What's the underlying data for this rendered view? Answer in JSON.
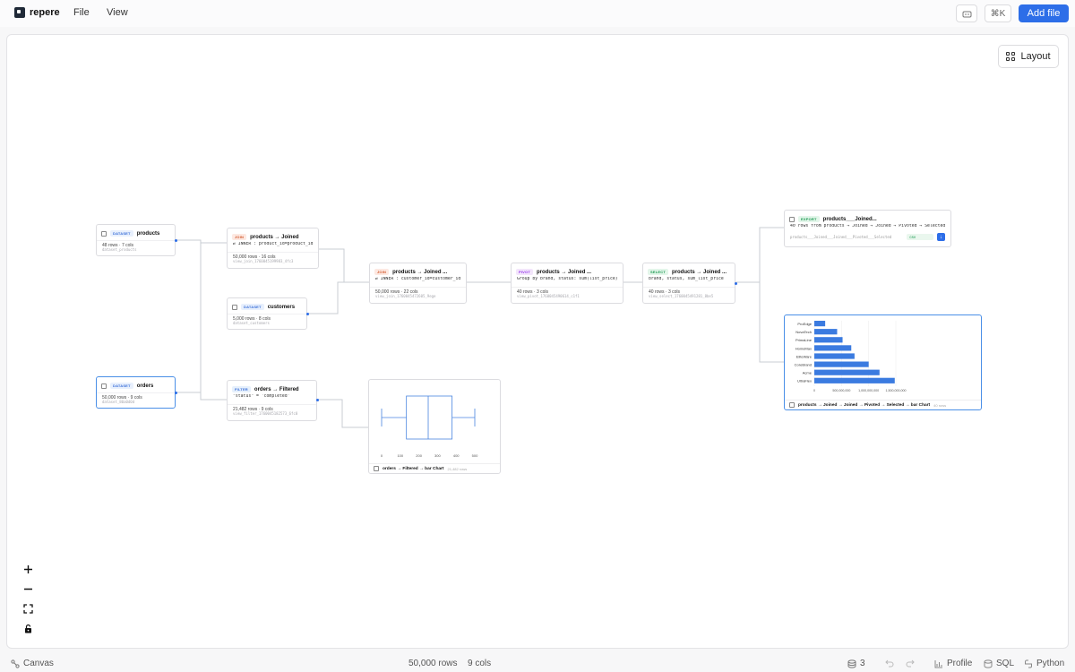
{
  "app": {
    "name": "repere"
  },
  "menu": {
    "file": "File",
    "view": "View"
  },
  "toolbar": {
    "shortcut": "⌘K",
    "add_file": "Add file",
    "layout": "Layout"
  },
  "nodes": {
    "products": {
      "badge": "DATASET",
      "title": "products",
      "meta": "48 rows · 7 cols",
      "sub": "dataset_products"
    },
    "customers": {
      "badge": "DATASET",
      "title": "customers",
      "meta": "5,000 rows · 8 cols",
      "sub": "dataset_customers"
    },
    "orders": {
      "badge": "DATASET",
      "title": "orders",
      "meta": "50,000 rows · 9 cols",
      "sub": "dataset_80a0d0d"
    },
    "join1": {
      "badge": "JOIN",
      "title": "products → Joined",
      "line": "⇄ INNER : product_id=product_id",
      "meta": "50,000 rows · 16 cols",
      "sub": "view_join_1760045199983_4fc3"
    },
    "join2": {
      "badge": "JOIN",
      "title": "products → Joined ...",
      "line": "⇄ INNER : customer_id=customer_id",
      "meta": "50,000 rows · 22 cols",
      "sub": "view_join_1760045472605_9ege"
    },
    "filter": {
      "badge": "FILTER",
      "title": "orders → Filtered",
      "line": "\"status\" = 'completed'",
      "meta": "21,482 rows · 9 cols",
      "sub": "view_filter_1760045182573_6fc0"
    },
    "pivot": {
      "badge": "PIVOT",
      "title": "products → Joined ...",
      "line": "Group by brand, status: sum(list_price)",
      "meta": "40 rows · 3 cols",
      "sub": "view_pivot_1760045490614_c1f1"
    },
    "select": {
      "badge": "SELECT",
      "title": "products → Joined ...",
      "line": "brand, status, sum_list_price",
      "meta": "40 rows · 3 cols",
      "sub": "view_select_1760045491281_8be5"
    },
    "export": {
      "badge": "EXPORT",
      "title": "products___Joined...",
      "line": "40 rows from products → Joined → Joined → Pivoted → Selected",
      "file": "products___Joined___Joined___Pivoted___Selected",
      "format": "csv"
    }
  },
  "box_chart": {
    "caption": "orders → Filtered → bar Chart",
    "count": "21,482 rows",
    "chart_data": {
      "type": "box",
      "ticks": [
        "0",
        "100",
        "200",
        "300",
        "400",
        "500"
      ],
      "whisker_low": 0,
      "q1": 133,
      "median": 250,
      "q3": 378,
      "whisker_high": 500
    }
  },
  "bar_chart": {
    "caption": "products → Joined → Joined → Pivoted → Selected → bar Chart",
    "count": "40 rows",
    "chart_data": {
      "type": "bar",
      "categories": [
        "ProEdge",
        "NovaTech",
        "PrimaLine",
        "HomeMax",
        "EliteWare",
        "CoreBrand",
        "Acme",
        "UltraFlex"
      ],
      "values": [
        200000000,
        420000000,
        520000000,
        680000000,
        740000000,
        1000000000,
        1200000000,
        1480000000
      ],
      "ticks": [
        "0",
        "500,000,000",
        "1,000,000,000",
        "1,500,000,000"
      ],
      "xlim": [
        0,
        1500000000
      ]
    }
  },
  "status": {
    "canvas": "Canvas",
    "rows": "50,000 rows",
    "cols": "9 cols",
    "count": "3",
    "profile": "Profile",
    "sql": "SQL",
    "python": "Python"
  }
}
